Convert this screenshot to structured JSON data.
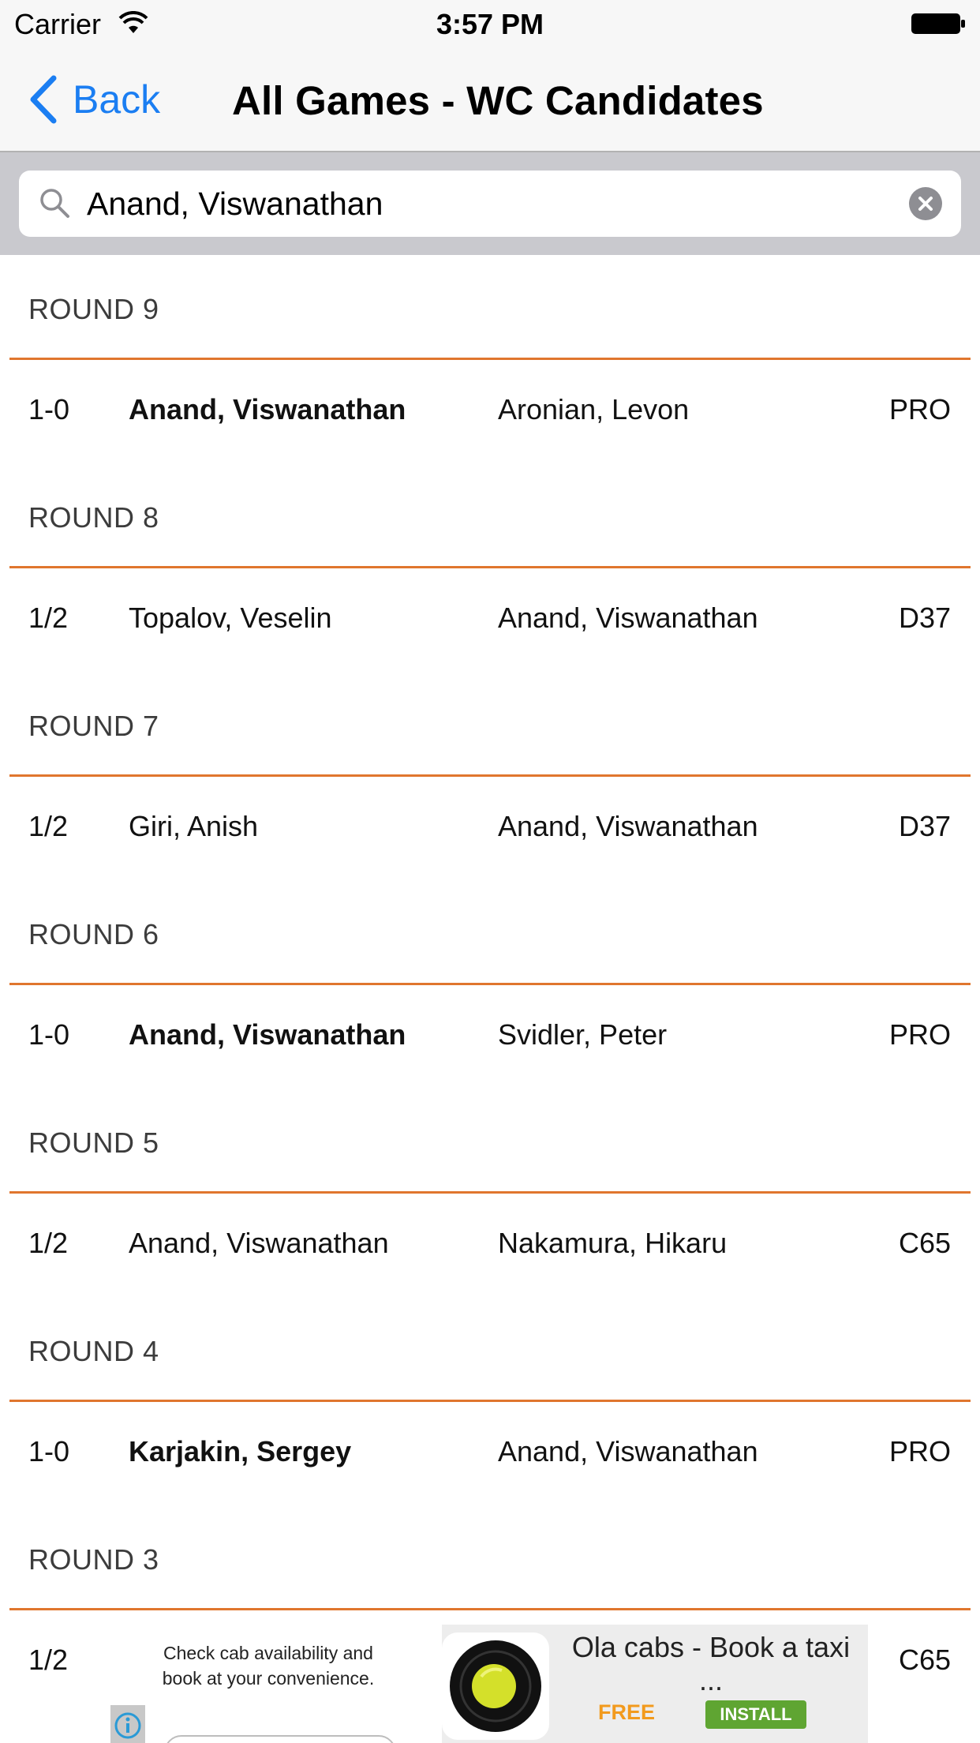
{
  "status_bar": {
    "carrier": "Carrier",
    "time": "3:57 PM"
  },
  "nav": {
    "back_label": "Back",
    "title": "All Games - WC Candidates"
  },
  "search": {
    "value": "Anand, Viswanathan"
  },
  "sections": [
    {
      "label": "ROUND 9",
      "game": {
        "result": "1-0",
        "white": "Anand, Viswanathan",
        "black": "Aronian, Levon",
        "eco": "PRO",
        "white_bold": true
      }
    },
    {
      "label": "ROUND 8",
      "game": {
        "result": "1/2",
        "white": "Topalov, Veselin",
        "black": "Anand, Viswanathan",
        "eco": "D37",
        "white_bold": false
      }
    },
    {
      "label": "ROUND 7",
      "game": {
        "result": "1/2",
        "white": "Giri, Anish",
        "black": "Anand, Viswanathan",
        "eco": "D37",
        "white_bold": false
      }
    },
    {
      "label": "ROUND 6",
      "game": {
        "result": "1-0",
        "white": "Anand, Viswanathan",
        "black": "Svidler, Peter",
        "eco": "PRO",
        "white_bold": true
      }
    },
    {
      "label": "ROUND 5",
      "game": {
        "result": "1/2",
        "white": "Anand, Viswanathan",
        "black": "Nakamura, Hikaru",
        "eco": "C65",
        "white_bold": false
      }
    },
    {
      "label": "ROUND 4",
      "game": {
        "result": "1-0",
        "white": "Karjakin, Sergey",
        "black": "Anand, Viswanathan",
        "eco": "PRO",
        "white_bold": true
      }
    },
    {
      "label": "ROUND 3",
      "game": {
        "result": "1/2",
        "white": "",
        "black": "",
        "eco": "C65",
        "white_bold": false
      }
    }
  ],
  "ad": {
    "copy": "Check cab availability and book at your convenience.",
    "title": "Ola cabs - Book a taxi ...",
    "free_label": "FREE",
    "install_label": "INSTALL"
  },
  "colors": {
    "accent": "#1b7ef2",
    "separator": "#e0762e",
    "search_bg": "#c9c9ce"
  }
}
